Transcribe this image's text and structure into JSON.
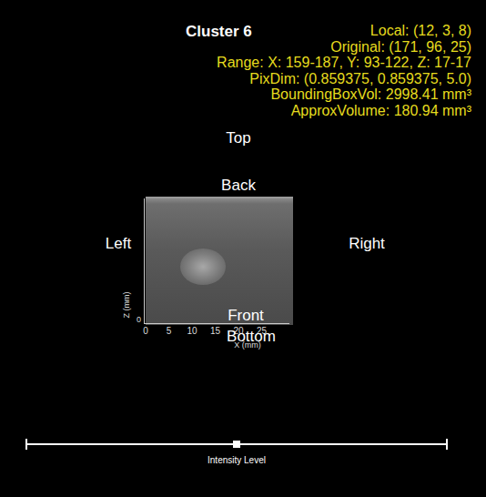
{
  "title": "Cluster 6",
  "info": [
    "Local: (12, 3, 8)",
    "Original: (171, 96, 25)",
    "Range: X: 159-187, Y: 93-122, Z: 17-17",
    "PixDim: (0.859375, 0.859375, 5.0)",
    "BoundingBoxVol: 2998.41 mm³",
    "ApproxVolume: 180.94 mm³"
  ],
  "orientation": [
    "Top",
    "Back",
    "Left",
    "Right",
    "Front",
    "Bottom"
  ],
  "axes": {
    "x_label": "X (mm)",
    "x_ticks": [
      "0",
      "5",
      "10",
      "15",
      "20",
      "25"
    ],
    "z_label": "Z (mm)",
    "z_ticks": [
      "0"
    ]
  },
  "slider": {
    "label": "Intensity Level",
    "level": 0.5
  }
}
